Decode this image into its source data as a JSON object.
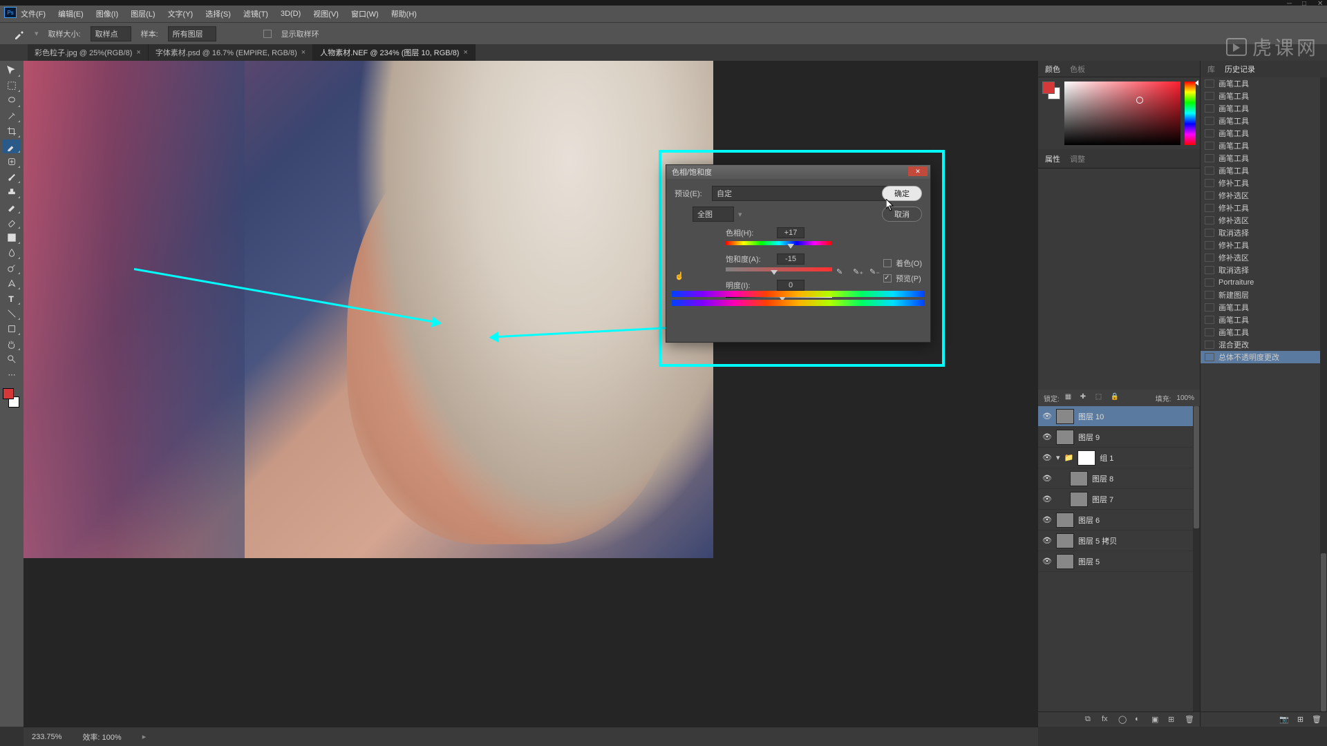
{
  "menubar": [
    "文件(F)",
    "编辑(E)",
    "图像(I)",
    "图层(L)",
    "文字(Y)",
    "选择(S)",
    "滤镜(T)",
    "3D(D)",
    "视图(V)",
    "窗口(W)",
    "帮助(H)"
  ],
  "optbar": {
    "sample_size_label": "取样大小:",
    "sample_size_value": "取样点",
    "sample_label": "样本:",
    "sample_value": "所有图层",
    "show_ring": "显示取样环"
  },
  "tabs": [
    {
      "label": "彩色粒子.jpg @ 25%(RGB/8)",
      "active": false
    },
    {
      "label": "字体素材.psd @ 16.7% (EMPIRE, RGB/8)",
      "active": false
    },
    {
      "label": "人物素材.NEF @ 234% (图层 10, RGB/8)",
      "active": true
    }
  ],
  "color_panel": {
    "tab1": "颜色",
    "tab2": "色板"
  },
  "props_panel": {
    "tab1": "属性",
    "tab2": "调整"
  },
  "layers": {
    "lock_label": "锁定:",
    "fill_label": "填充:",
    "fill_value": "100%",
    "rows": [
      {
        "name": "图层 10",
        "sel": true,
        "indent": 0,
        "hasMask": false
      },
      {
        "name": "图层 9",
        "sel": false,
        "indent": 0,
        "hasMask": false
      },
      {
        "name": "组 1",
        "sel": false,
        "indent": 0,
        "group": true,
        "hasMask": true
      },
      {
        "name": "图层 8",
        "sel": false,
        "indent": 1,
        "hasMask": false
      },
      {
        "name": "图层 7",
        "sel": false,
        "indent": 1,
        "hasMask": false
      },
      {
        "name": "图层 6",
        "sel": false,
        "indent": 0,
        "hasMask": false
      },
      {
        "name": "图层 5 拷贝",
        "sel": false,
        "indent": 0,
        "hasMask": false
      },
      {
        "name": "图层 5",
        "sel": false,
        "indent": 0,
        "hasMask": false
      }
    ]
  },
  "history": {
    "tab1": "库",
    "tab2": "历史记录",
    "items": [
      "画笔工具",
      "画笔工具",
      "画笔工具",
      "画笔工具",
      "画笔工具",
      "画笔工具",
      "画笔工具",
      "画笔工具",
      "修补工具",
      "修补选区",
      "修补工具",
      "修补选区",
      "取消选择",
      "修补工具",
      "修补选区",
      "取消选择",
      "Portraiture",
      "新建图层",
      "画笔工具",
      "画笔工具",
      "画笔工具",
      "混合更改",
      "总体不透明度更改"
    ],
    "sel_index": 22
  },
  "status": {
    "zoom": "233.75%",
    "efficiency": "效率: 100%"
  },
  "dialog": {
    "title": "色相/饱和度",
    "preset_label": "预设(E):",
    "preset_value": "自定",
    "range_value": "全图",
    "hue_label": "色相(H):",
    "hue_value": "+17",
    "sat_label": "饱和度(A):",
    "sat_value": "-15",
    "lig_label": "明度(I):",
    "lig_value": "0",
    "ok": "确定",
    "cancel": "取消",
    "colorize": "着色(O)",
    "preview": "预览(P)"
  },
  "watermark": "虎课网"
}
